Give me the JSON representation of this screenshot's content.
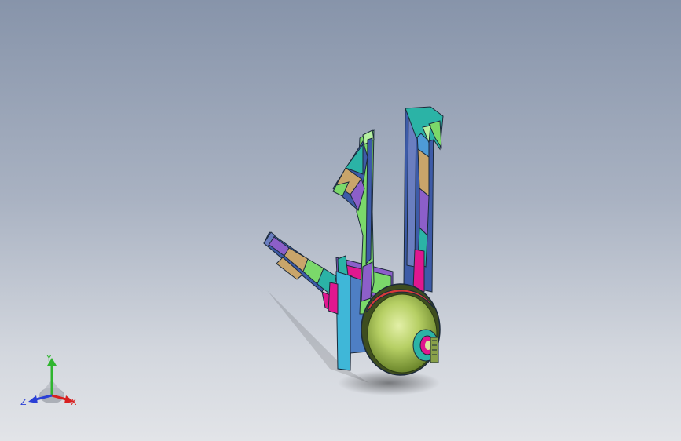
{
  "viewport": {
    "background_top": "#8794aa",
    "background_bottom": "#e2e4e8"
  },
  "model": {
    "description_icon": "spacecraft-model-icon",
    "colors": {
      "dome": "#a8c05a",
      "dome_highlight": "#e3f0a8",
      "dome_ring": "#d63a3a",
      "panel_green": "#7bd86a",
      "panel_purple": "#8c5fc9",
      "panel_magenta": "#e0178f",
      "panel_teal": "#2bb3a6",
      "panel_blue": "#3d5ba8",
      "panel_tan": "#c9a56a",
      "panel_cyan": "#3fb7d8",
      "edge": "#1c2a3a"
    }
  },
  "triad": {
    "y_label": "Y",
    "z_label": "Z",
    "x_label": "X",
    "y_color": "#2fb52f",
    "z_color": "#2a3fd6",
    "x_color": "#d82020"
  }
}
